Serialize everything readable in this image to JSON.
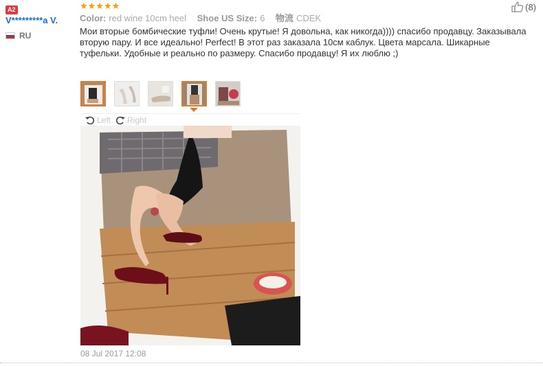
{
  "reviewer": {
    "level_badge": "A2",
    "name": "V*********a V.",
    "country": "RU"
  },
  "review": {
    "stars": "★★★★★",
    "color_label": "Color:",
    "color_value": "red wine 10cm heel",
    "size_label": "Shoe US Size:",
    "size_value": "6",
    "logistics_label": "物流",
    "logistics_value": "CDEK",
    "text": "Мои вторые бомбические туфли! Очень крутые! Я довольна, как никогда)))) спасибо продавцу. Заказывала вторую пару. И все идеально! Perfect! В этот раз заказала 10см каблук. Цвета марсала. Шикарные туфельки. Удобные и реально по размеру. Спасибо продавцу! Я их люблю ;)",
    "date": "08 Jul 2017 12:08",
    "likes": "(8)"
  },
  "gallery": {
    "rotate_left": "Left",
    "rotate_right": "Right",
    "selected_index": 3
  },
  "colors": {
    "star": "#ff9a00",
    "username": "#1a6fc4",
    "badge": "#e4393c",
    "selected_border": "#e07a2e"
  }
}
